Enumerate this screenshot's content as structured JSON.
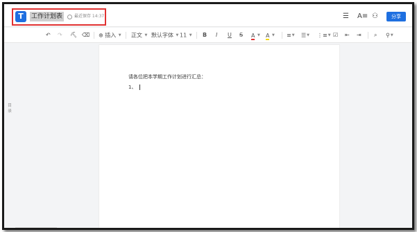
{
  "header": {
    "logo_letter": "T",
    "doc_title": "工作计划表",
    "save_status": "最近保存 14:37",
    "share_label": "分享",
    "icons": [
      "menu-icon",
      "text-style-icon",
      "collaborator-icon"
    ]
  },
  "toolbar": {
    "insert_label": "插入",
    "style_label": "正文",
    "font_label": "默认字体",
    "size_label": "11",
    "bold": "B",
    "italic": "I",
    "underline": "U",
    "strike": "S",
    "font_color": "A",
    "highlight": "A"
  },
  "sidebar": {
    "tab_label": "目录"
  },
  "document": {
    "line1": "请各位把本学期工作计划进行汇总：",
    "line2": "1、"
  },
  "colors": {
    "accent": "#1e6fe0",
    "highlight_box": "#e03131",
    "font_color_bar": "#e03131",
    "highlight_bar": "#f5d90a"
  }
}
